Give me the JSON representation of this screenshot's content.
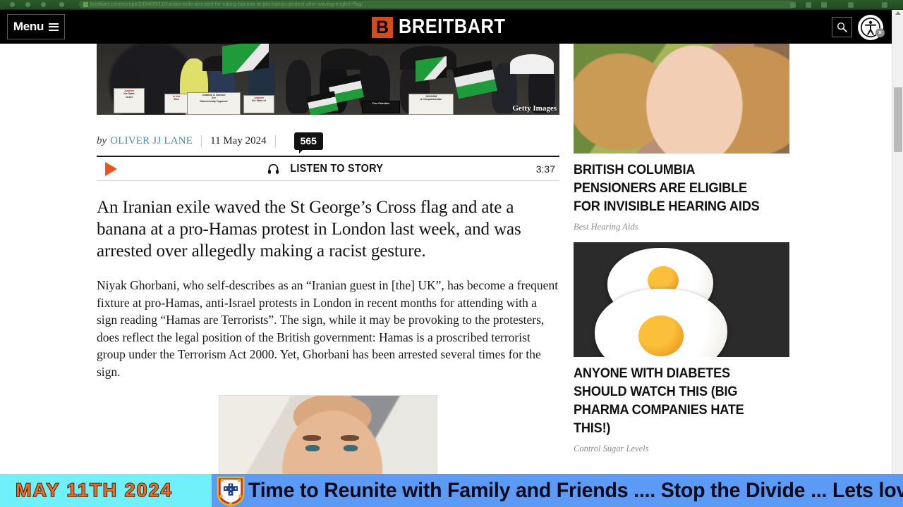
{
  "browser": {
    "url_text": "breitbart.com/europe/2024/05/11/iranian-exile-arrested-for-eating-banana-at-pro-hamas-protest-after-waving-english-flag/"
  },
  "header": {
    "menu_label": "Menu",
    "menu_icon": "hamburger-icon",
    "brand_mark": "B",
    "brand_name": "BREITBART",
    "search_icon": "search-icon",
    "accessibility_icon": "accessibility-icon",
    "accessibility_badge": "×"
  },
  "article": {
    "hero": {
      "credit": "Getty Images",
      "signs": [
        "Judaism Is Not Zionism",
        "Judaism & Zionism Are Diametrically Opposed",
        "Judaism Denounces the State of Israel",
        "Free Palestine",
        "JUDAISM & Compassionate"
      ]
    },
    "byline": {
      "by_label": "by",
      "author": "OLIVER JJ LANE",
      "date": "11 May 2024",
      "comment_count": "565"
    },
    "audio": {
      "play_icon": "play-icon",
      "headphones_icon": "headphones-icon",
      "label": "LISTEN TO STORY",
      "duration": "3:37"
    },
    "lede": "An Iranian exile waved the St George’s Cross flag and ate a banana at a pro-Hamas protest in London last week, and was arrested over allegedly making a racist gesture.",
    "body_paragraph": "Niyak Ghorbani, who self-describes as an “Iranian guest in [the] UK”, has become a frequent fixture at pro-Hamas, anti-Israel protests in London in recent months for attending with a sign reading “Hamas are Terrorists”. The sign, while it may be provoking to the protesters, does reflect the legal position of the British government: Hamas is a proscribed terrorist group under the Terrorism Act 2000. Yet, Ghorbani has been arrested several times for the sign."
  },
  "sidebar": {
    "promos": [
      {
        "image_name": "smiling-woman-photo",
        "title": "BRITISH COLUMBIA PENSIONERS ARE ELIGIBLE FOR INVISIBLE HEARING AIDS",
        "source": "Best Hearing Aids"
      },
      {
        "image_name": "fried-eggs-photo",
        "title": "ANYONE WITH DIABETES SHOULD WATCH THIS (BIG PHARMA COMPANIES HATE THIS!)",
        "source": "Control Sugar Levels"
      }
    ]
  },
  "ticker": {
    "date": "MAY  11TH  2024",
    "crest_icon": "portugal-coat-of-arms-icon",
    "message": "Time to Reunite with Family and Friends ....   Stop the Divide ...   Lets love one anot"
  },
  "colors": {
    "brand_orange": "#d84b16",
    "play_orange": "#e8561f",
    "author_link": "#4a90a4",
    "ticker_cyan": "#6ff0fa",
    "ticker_blue": "#5b9bf5",
    "ticker_date_orange": "#ef6a1e"
  }
}
